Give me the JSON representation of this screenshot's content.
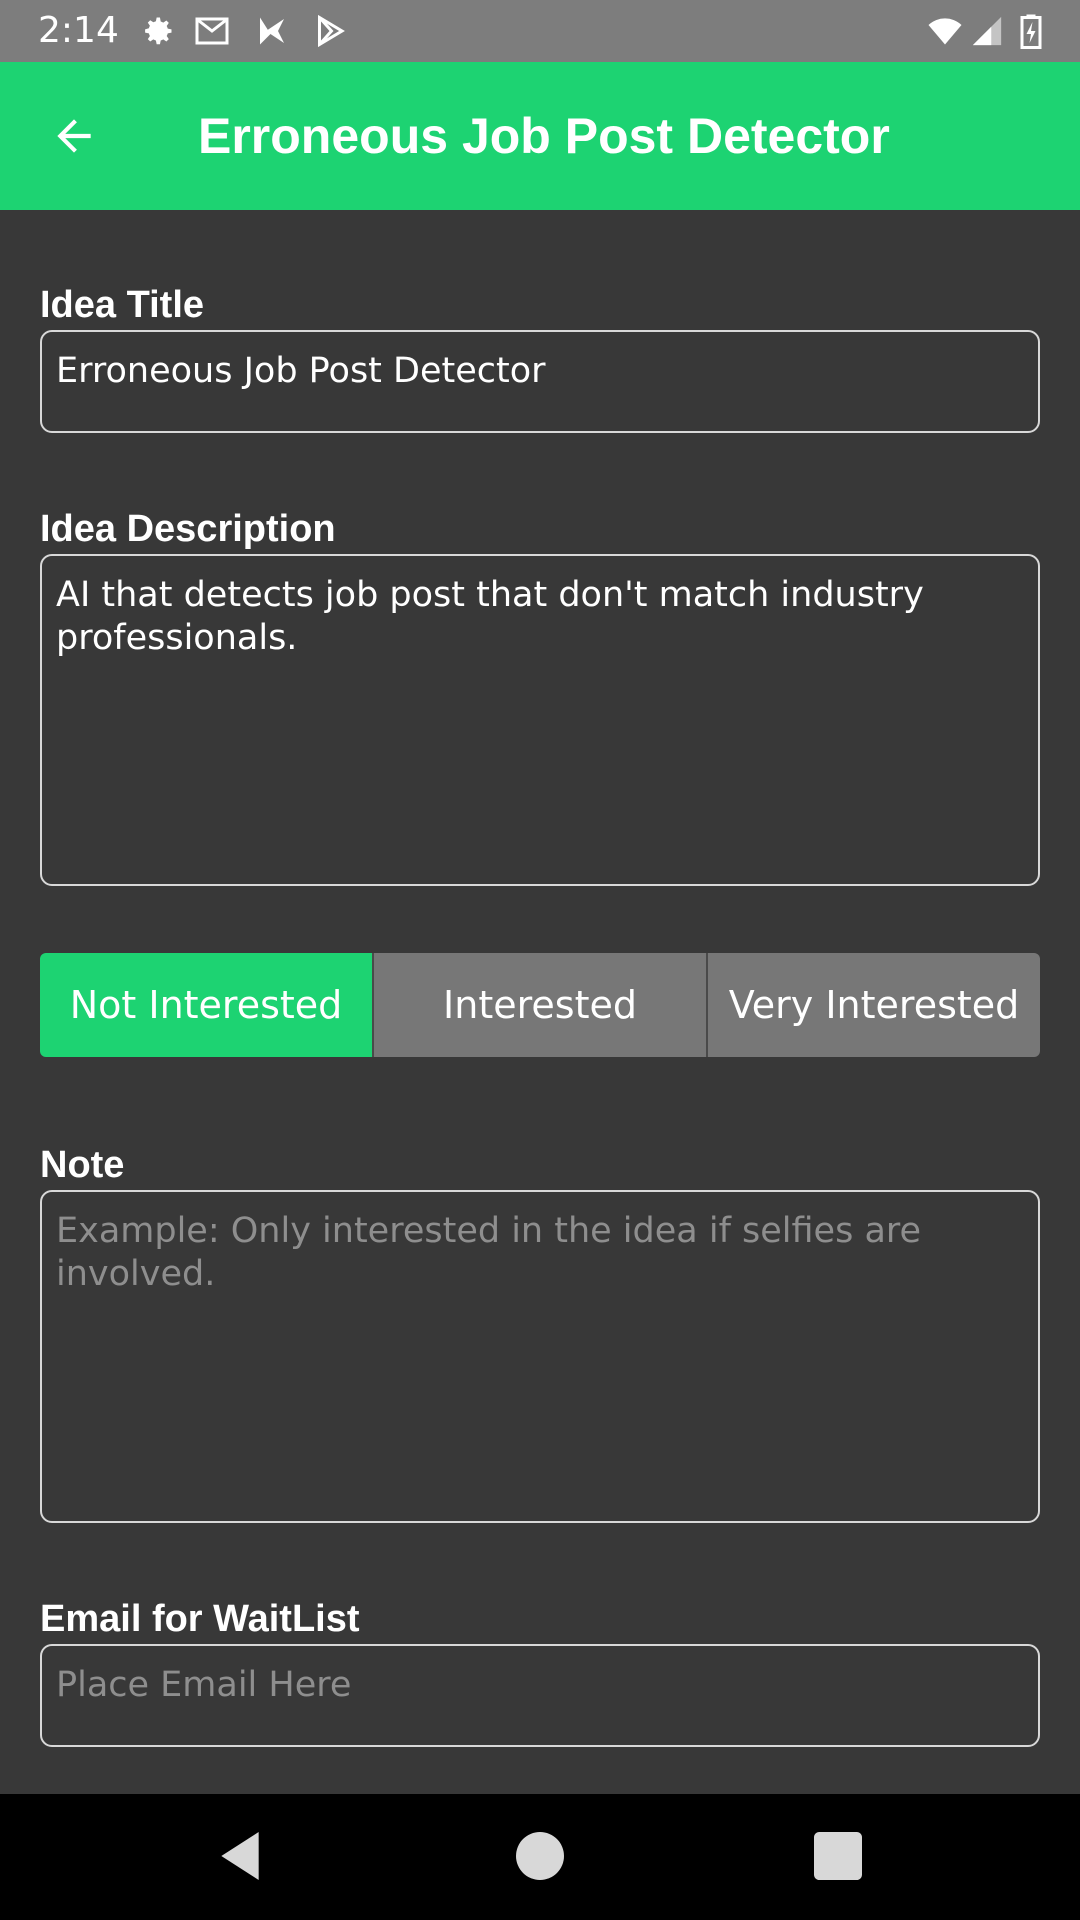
{
  "status_bar": {
    "time": "2:14",
    "left_icons": [
      "gear-icon",
      "gmail-icon",
      "play-store-icon",
      "play-icon"
    ],
    "right_icons": [
      "wifi-icon",
      "signal-icon",
      "battery-icon"
    ]
  },
  "app_bar": {
    "title": "Erroneous Job Post Detector",
    "back_icon": "arrow-left-icon"
  },
  "form": {
    "idea_title_label": "Idea Title",
    "idea_title_value": "Erroneous Job Post Detector",
    "idea_description_label": "Idea Description",
    "idea_description_value": "AI that detects job post that don't match industry professionals.",
    "interest_options": [
      "Not Interested",
      "Interested",
      "Very Interested"
    ],
    "interest_selected": "Not Interested",
    "note_label": "Note",
    "note_placeholder": "Example: Only interested in the idea if selfies are involved.",
    "email_label": "Email for WaitList",
    "email_placeholder": "Place Email Here"
  },
  "colors": {
    "accent": "#1dd372",
    "background": "#383838",
    "segment_inactive": "#777777"
  }
}
